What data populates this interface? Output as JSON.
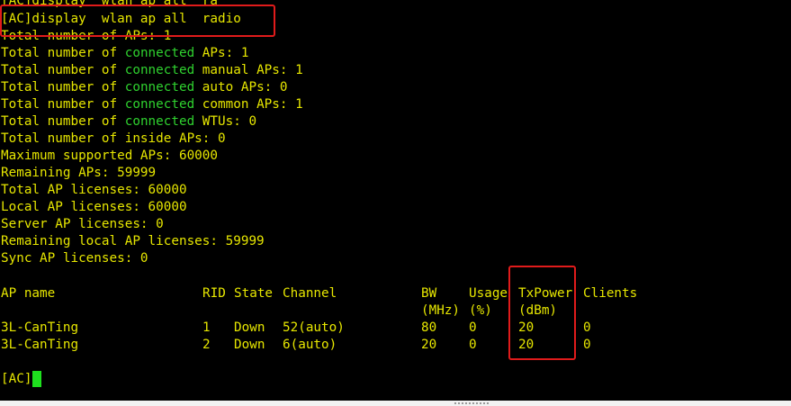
{
  "terminal": {
    "partial_top_line": "[AC]display  wlan ap all  ra",
    "command_line": "[AC]display  wlan ap all  radio",
    "summary": [
      {
        "text": "Total number of APs: 1"
      },
      {
        "pre": "Total number of ",
        "green": "connected",
        "post": " APs: 1"
      },
      {
        "pre": "Total number of ",
        "green": "connected",
        "post": " manual APs: 1"
      },
      {
        "pre": "Total number of ",
        "green": "connected",
        "post": " auto APs: 0"
      },
      {
        "pre": "Total number of ",
        "green": "connected",
        "post": " common APs: 1"
      },
      {
        "pre": "Total number of ",
        "green": "connected",
        "post": " WTUs: 0"
      },
      {
        "text": "Total number of inside APs: 0"
      },
      {
        "text": "Maximum supported APs: 60000"
      },
      {
        "text": "Remaining APs: 59999"
      },
      {
        "text": "Total AP licenses: 60000"
      },
      {
        "text": "Local AP licenses: 60000"
      },
      {
        "text": "Server AP licenses: 0"
      },
      {
        "text": "Remaining local AP licenses: 59999"
      },
      {
        "text": "Sync AP licenses: 0"
      }
    ],
    "table": {
      "headers": [
        "AP name",
        "RID",
        "State",
        "Channel",
        "BW",
        "Usage",
        "TxPower",
        "Clients"
      ],
      "header_units": [
        "",
        "",
        "",
        "",
        "(MHz)",
        "(%)",
        "(dBm)",
        ""
      ],
      "rows": [
        [
          "3L-CanTing",
          "1",
          "Down",
          "52(auto)",
          "80",
          "0",
          "20",
          "0"
        ],
        [
          "3L-CanTing",
          "2",
          "Down",
          "6(auto)",
          "20",
          "0",
          "20",
          "0"
        ]
      ]
    },
    "prompt": "[AC]"
  },
  "colors": {
    "background": "#000000",
    "text": "#e6e600",
    "keyword": "#2fd22f",
    "highlight_border": "#e01b1b",
    "cursor": "#1ee11e"
  }
}
